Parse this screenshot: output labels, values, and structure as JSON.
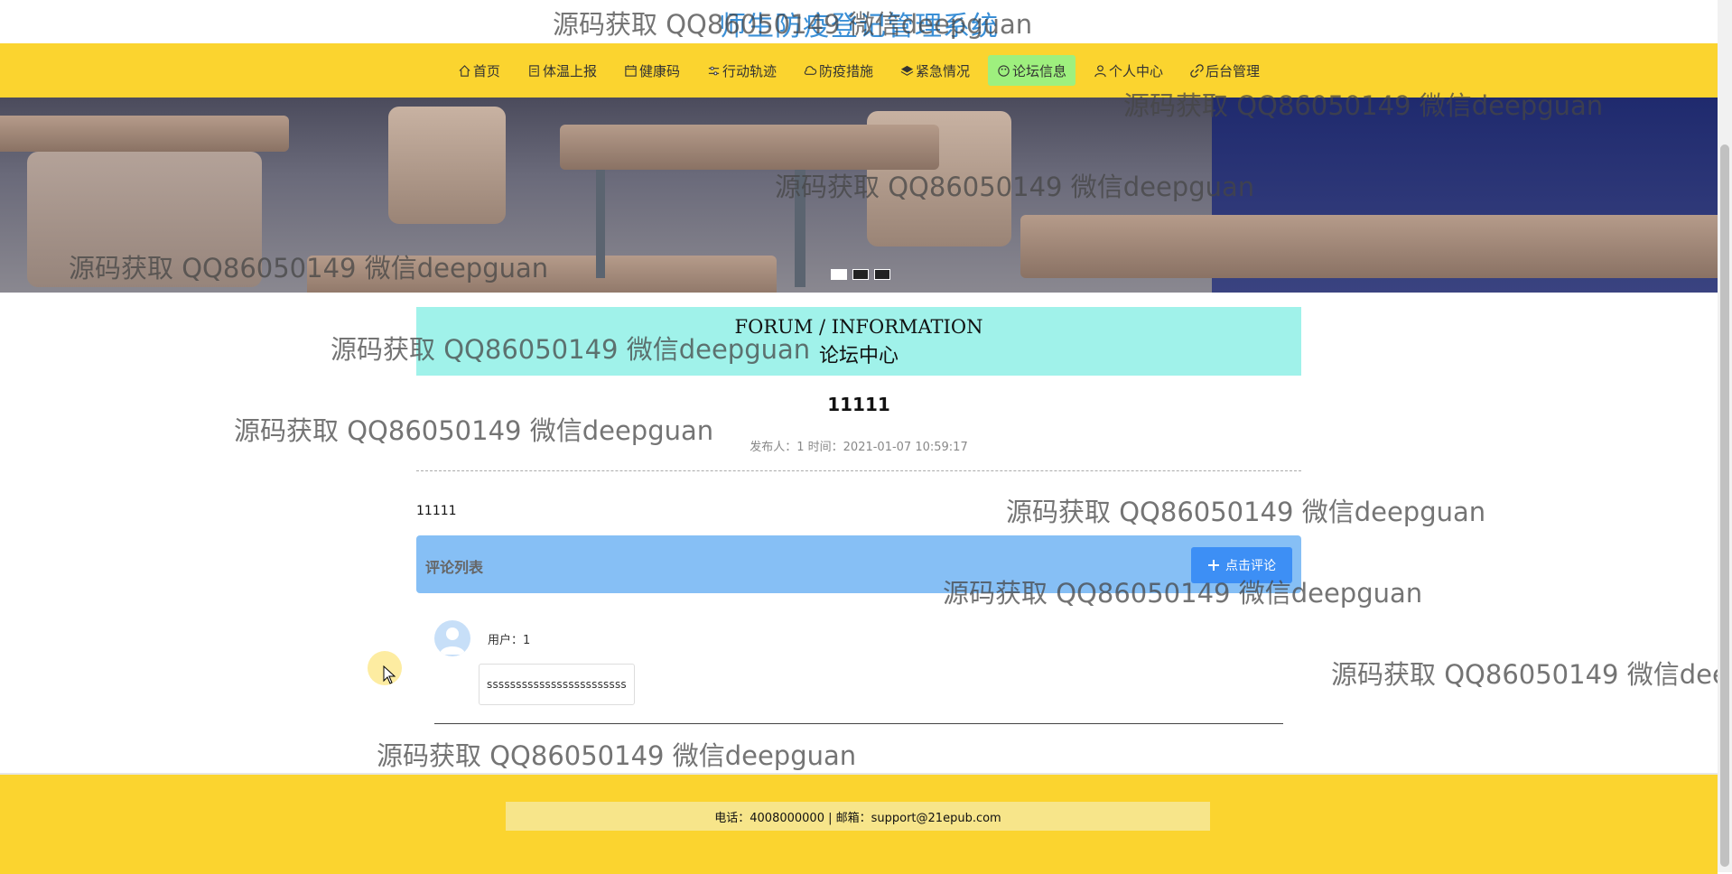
{
  "site": {
    "title": "师生防疫登记管理系统"
  },
  "nav": {
    "items": [
      {
        "label": "首页",
        "icon": "home-icon",
        "active": false
      },
      {
        "label": "体温上报",
        "icon": "clipboard-icon",
        "active": false
      },
      {
        "label": "健康码",
        "icon": "calendar-icon",
        "active": false
      },
      {
        "label": "行动轨迹",
        "icon": "sliders-icon",
        "active": false
      },
      {
        "label": "防疫措施",
        "icon": "cloud-icon",
        "active": false
      },
      {
        "label": "紧急情况",
        "icon": "layers-icon",
        "active": false
      },
      {
        "label": "论坛信息",
        "icon": "palette-icon",
        "active": true
      },
      {
        "label": "个人中心",
        "icon": "user-icon",
        "active": false
      },
      {
        "label": "后台管理",
        "icon": "link-icon",
        "active": false
      }
    ]
  },
  "banner": {
    "slides": 3,
    "active_slide": 1
  },
  "section": {
    "title_en": "FORUM / INFORMATION",
    "title_cn": "论坛中心"
  },
  "post": {
    "title": "11111",
    "meta": "发布人：1 时间：2021-01-07 10:59:17",
    "body": "11111"
  },
  "comments": {
    "header": "评论列表",
    "add_button": "点击评论",
    "items": [
      {
        "user": "用户：1",
        "content": "ssssssssssssssssssssssss"
      }
    ]
  },
  "footer": {
    "contact": "电话：4008000000 | 邮箱：support@21epub.com"
  },
  "watermark": {
    "text": "源码获取 QQ86050149 微信deepguan"
  },
  "colors": {
    "nav_bg": "#fbd42f",
    "nav_active": "#9ef07e",
    "section_head": "#a0f2ea",
    "comments_bar": "#86bff5",
    "button": "#3d8ff5"
  }
}
